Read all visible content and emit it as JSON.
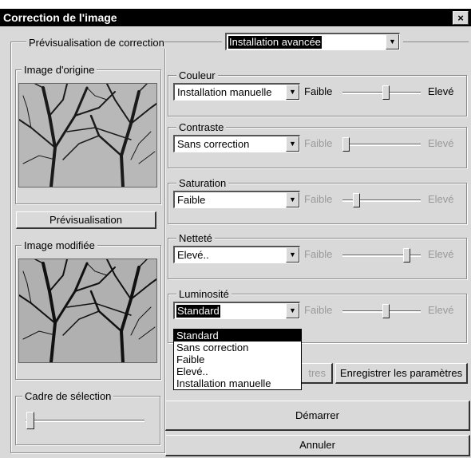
{
  "window": {
    "title": "Correction de l'image",
    "close_glyph": "×"
  },
  "preview_section": {
    "label": "Prévisualisation de correction",
    "mode_value": "Installation avancée"
  },
  "original": {
    "label": "Image d'origine"
  },
  "preview_button": "Prévisualisation",
  "modified": {
    "label": "Image modifiée"
  },
  "crop": {
    "label": "Cadre de sélection"
  },
  "slider_low": "Faible",
  "slider_high": "Elevé",
  "controls": [
    {
      "label": "Couleur",
      "value": "Installation manuelle",
      "enabled": true,
      "level": 0.56
    },
    {
      "label": "Contraste",
      "value": "Sans correction",
      "enabled": false,
      "level": 0.0
    },
    {
      "label": "Saturation",
      "value": "Faible",
      "enabled": false,
      "level": 0.15
    },
    {
      "label": "Netteté",
      "value": "Elevé..",
      "enabled": false,
      "level": 0.85
    },
    {
      "label": "Luminosité",
      "value": "Standard",
      "enabled": false,
      "level": 0.56
    }
  ],
  "dropdown_options": [
    "Standard",
    "Sans correction",
    "Faible",
    "Elevé..",
    "Installation manuelle"
  ],
  "buttons": {
    "load_partial": "tres",
    "save": "Enregistrer les paramètres",
    "start": "Démarrer",
    "cancel": "Annuler"
  },
  "crop_level": 0.0
}
